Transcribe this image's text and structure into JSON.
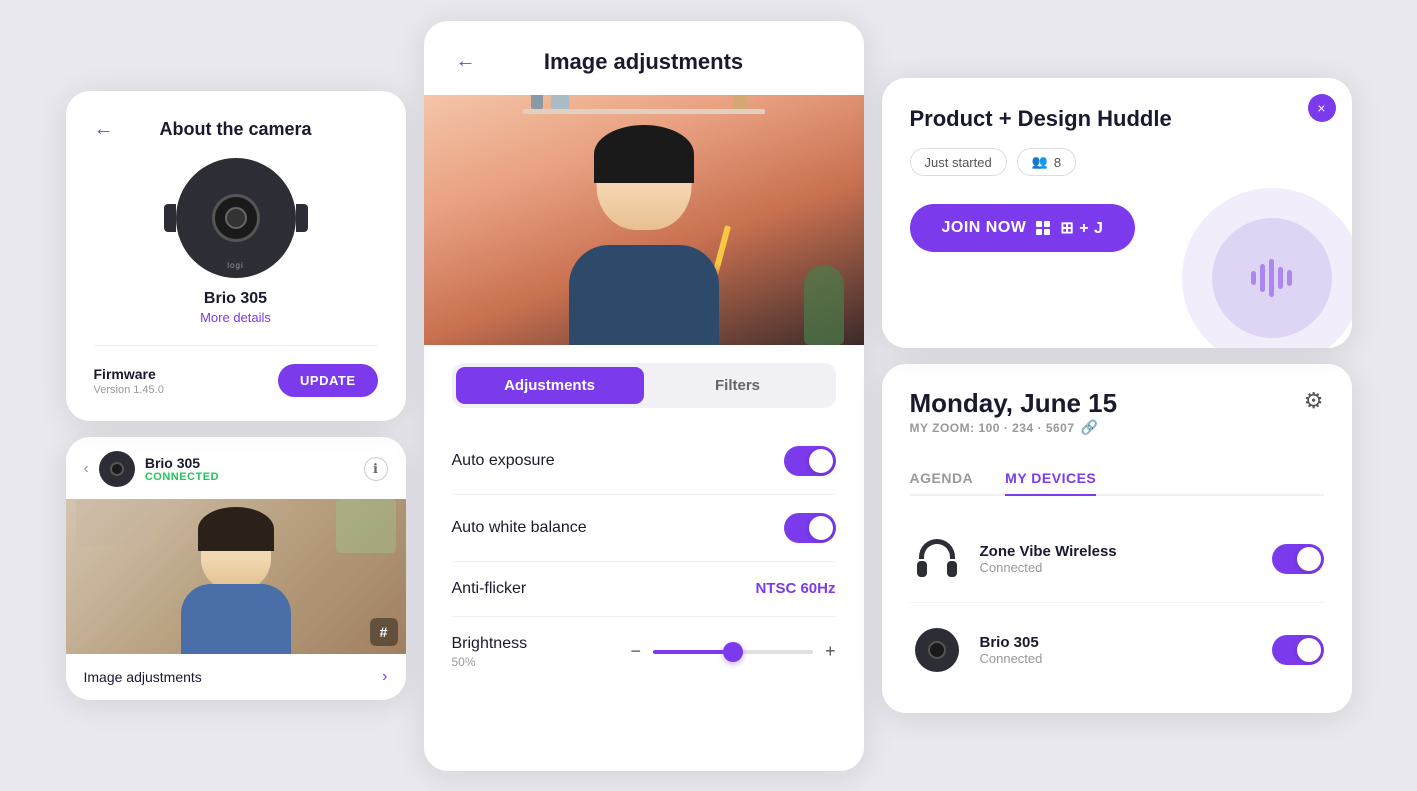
{
  "leftCol": {
    "cameraCard": {
      "backLabel": "←",
      "title": "About the camera",
      "deviceName": "Brio 305",
      "moreDetails": "More details",
      "firmwareLabel": "Firmware",
      "firmwareVersion": "Version 1.45.0",
      "updateButton": "UPDATE"
    },
    "previewCard": {
      "prevButton": "‹",
      "deviceName": "Brio 305",
      "connectedStatus": "CONNECTED",
      "hashBadge": "#",
      "imageAdjLabel": "Image adjustments",
      "chevron": "›"
    }
  },
  "middleCol": {
    "backLabel": "←",
    "title": "Image adjustments",
    "tabs": [
      {
        "id": "adjustments",
        "label": "Adjustments",
        "active": true
      },
      {
        "id": "filters",
        "label": "Filters",
        "active": false
      }
    ],
    "settings": [
      {
        "id": "auto-exposure",
        "label": "Auto exposure",
        "type": "toggle",
        "value": true
      },
      {
        "id": "auto-white-balance",
        "label": "Auto white balance",
        "type": "toggle",
        "value": true
      },
      {
        "id": "anti-flicker",
        "label": "Anti-flicker",
        "type": "select",
        "value": "NTSC 60Hz"
      },
      {
        "id": "brightness",
        "label": "Brightness",
        "type": "slider",
        "value": 50,
        "pct": "50%"
      }
    ]
  },
  "rightCol": {
    "meetingCard": {
      "closeLabel": "×",
      "title": "Product + Design Huddle",
      "statusBadge": "Just started",
      "peopleCount": "8",
      "joinButton": "JOIN NOW",
      "shortcut": "⊞ + J"
    },
    "calCard": {
      "date": "Monday, June 15",
      "zoomLabel": "MY ZOOM: 100 · 234 · 5607",
      "settingsIcon": "⚙",
      "tabs": [
        {
          "id": "agenda",
          "label": "AGENDA",
          "active": false
        },
        {
          "id": "my-devices",
          "label": "MY DEVICES",
          "active": true
        }
      ],
      "devices": [
        {
          "id": "zone-vibe",
          "name": "Zone Vibe Wireless",
          "status": "Connected",
          "type": "headphone",
          "toggleOn": true
        },
        {
          "id": "brio-305",
          "name": "Brio 305",
          "status": "Connected",
          "type": "camera",
          "toggleOn": true
        }
      ]
    }
  }
}
